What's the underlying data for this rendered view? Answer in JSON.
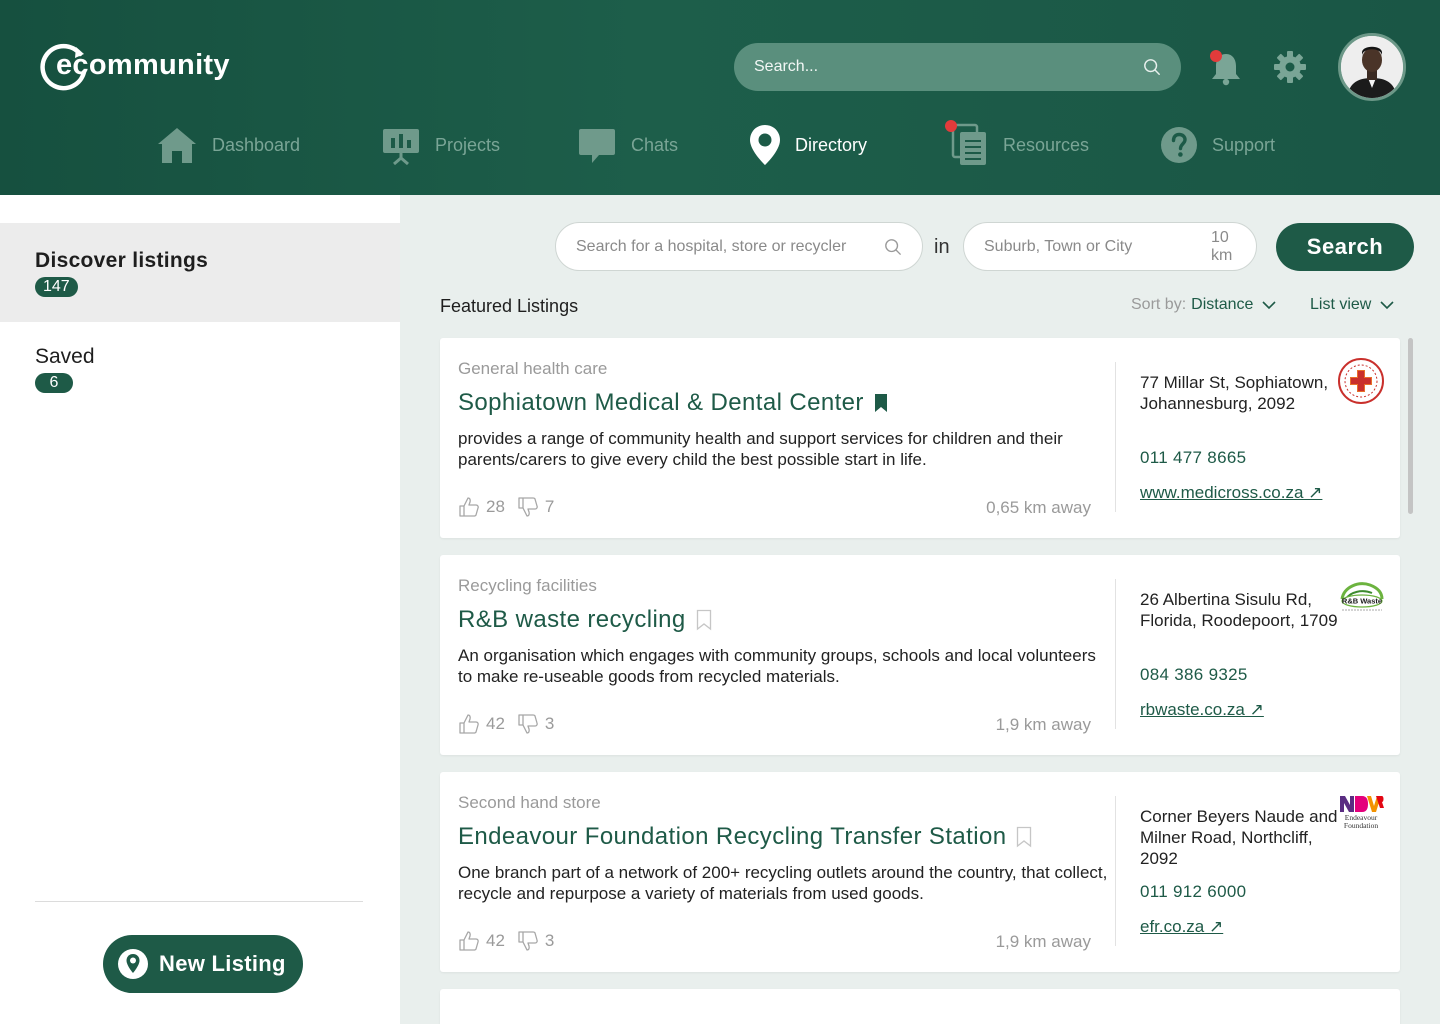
{
  "brand": {
    "name": "ecommunity"
  },
  "header": {
    "search_placeholder": "Search...",
    "nav": [
      {
        "label": "Dashboard",
        "icon": "home-icon",
        "active": false
      },
      {
        "label": "Projects",
        "icon": "presentation-icon",
        "active": false
      },
      {
        "label": "Chats",
        "icon": "chat-icon",
        "active": false
      },
      {
        "label": "Directory",
        "icon": "location-pin-icon",
        "active": true
      },
      {
        "label": "Resources",
        "icon": "documents-icon",
        "active": false,
        "notification": true
      },
      {
        "label": "Support",
        "icon": "help-icon",
        "active": false
      }
    ]
  },
  "sidebar": {
    "items": [
      {
        "label": "Discover listings",
        "count": "147",
        "active": true
      },
      {
        "label": "Saved",
        "count": "6",
        "active": false
      }
    ],
    "new_listing": "New Listing"
  },
  "search": {
    "query_placeholder": "Search for a hospital, store or recycler",
    "in_word": "in",
    "location_placeholder": "Suburb, Town or City",
    "radius": "10 km",
    "button": "Search"
  },
  "listing_header": {
    "title": "Featured Listings",
    "sort_label": "Sort by:",
    "sort_value": "Distance",
    "view": "List view"
  },
  "listings": [
    {
      "category": "General health care",
      "name": "Sophiatown Medical & Dental Center",
      "saved": true,
      "description": "provides a range of community health and support services for children and their parents/carers to give every child the best possible start in life.",
      "likes": "28",
      "dislikes": "7",
      "distance": "0,65 km away",
      "address": "77 Millar St, Sophiatown, Johannesburg, 2092",
      "phone": "011 477 8665",
      "website": "www.medicross.co.za ↗",
      "logo": "medicross-logo"
    },
    {
      "category": "Recycling facilities",
      "name": "R&B waste recycling",
      "saved": false,
      "description": "An organisation which engages with community groups, schools and local volunteers to make re-useable goods from recycled materials.",
      "likes": "42",
      "dislikes": "3",
      "distance": "1,9 km away",
      "address": "26 Albertina Sisulu Rd, Florida, Roodepoort, 1709",
      "phone": "084 386 9325",
      "website": "rbwaste.co.za ↗",
      "logo": "rb-waste-logo",
      "logo_text": "R&B Waste"
    },
    {
      "category": "Second hand store",
      "name": "Endeavour Foundation Recycling Transfer Station",
      "saved": false,
      "description": "One branch part of a network of 200+ recycling outlets around the country, that collect, recycle and repurpose a variety of materials from used goods.",
      "likes": "42",
      "dislikes": "3",
      "distance": "1,9 km away",
      "address": "Corner Beyers Naude and Milner Road, Northcliff, 2092",
      "phone": "011 912 6000",
      "website": "efr.co.za ↗",
      "logo": "endeavour-foundation-logo",
      "logo_text": "Endeavour Foundation"
    }
  ],
  "colors": {
    "brand_green": "#1e5a47",
    "header_green": "#1a5645",
    "muted_nav": "#7aa596",
    "notification": "#e23b3b",
    "background": "#e9efed"
  }
}
